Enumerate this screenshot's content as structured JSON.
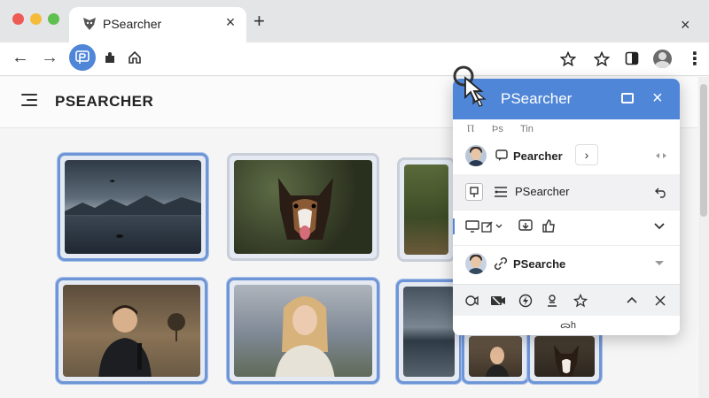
{
  "browser": {
    "tab_title": "PSearcher",
    "tab_close": "×",
    "new_tab": "+",
    "window_close": "×"
  },
  "toolbar": {
    "back_icon": "←",
    "forward_icon": "→",
    "menu": "⋮"
  },
  "page": {
    "brand": "PSEARCHER"
  },
  "popup": {
    "title": "PSearcher",
    "close": "×",
    "tabs": [
      "Ⲡ",
      "Ϸs",
      "Tin"
    ],
    "rows": [
      {
        "label": "Pearcher",
        "action": "›"
      },
      {
        "label": "PSearcher"
      },
      {
        "label": ""
      },
      {
        "label": "PSearche"
      }
    ],
    "footer_logo": "ᯅh"
  },
  "colors": {
    "accent": "#4f86d8",
    "selection_border": "#6e95d6"
  },
  "icons": {
    "ext_active": "psearcher-icon",
    "puzzle": "extensions-icon",
    "star": "bookmark-star-icon"
  }
}
